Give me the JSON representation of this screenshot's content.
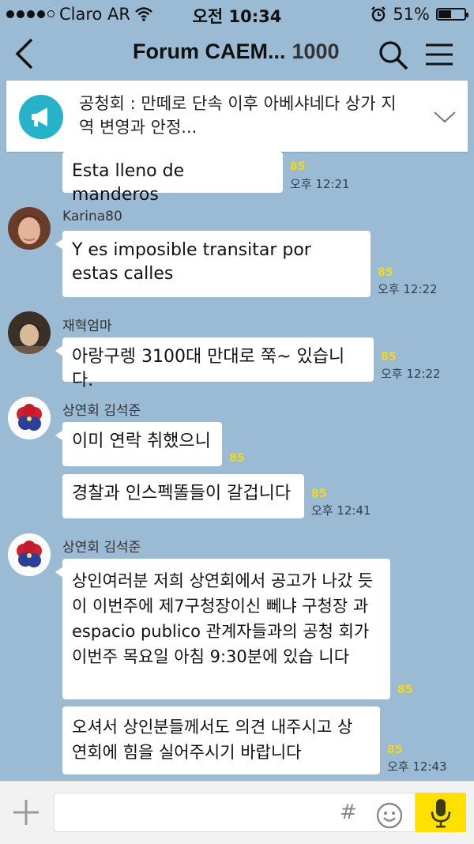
{
  "status": {
    "carrier": "Claro AR",
    "time": "오전 10:34",
    "battery": "51%",
    "battery_level": 0.51
  },
  "header": {
    "title": "Forum CAEM...",
    "member_count": "1000"
  },
  "notice": {
    "text": "공청회 : 만떼로 단속 이후 아베샤네다 상가 지역 변영과 안정..."
  },
  "messages": [
    {
      "text": "Esta lleno de manderos",
      "unread": "85",
      "time": "오후 12:21"
    },
    {
      "sender": "Karina80",
      "text": "Y es imposible transitar por estas calles",
      "unread": "85",
      "time": "오후 12:22"
    },
    {
      "sender": "재혁엄마",
      "text": "아랑구렝 3100대 만대로 쭉~ 있습니다.",
      "unread": "85",
      "time": "오후 12:22"
    },
    {
      "sender": "상연회 김석준",
      "text": "이미 연락 취했으니",
      "unread": "85"
    },
    {
      "text": "경찰과 인스펙똘들이 갈겁니다",
      "unread": "85",
      "time": "오후 12:41"
    },
    {
      "sender": "상연회 김석준",
      "text": "상인여러분 저희 상연회에서 공고가 나갔 듯이 이번주에 제7구청장이신 뻬냐 구청장 과 espacio publico 관계자들과의 공청 회가 이번주 목요일 아침 9:30분에 있습 니다",
      "unread": "85"
    },
    {
      "text": "오셔서 상인분들께서도 의견 내주시고 상 연회에 힘을 실어주시기 바랍니다",
      "unread": "85",
      "time": "오후 12:43"
    }
  ],
  "input": {
    "hash": "#"
  },
  "colors": {
    "background": "#9bbbd4",
    "unread": "#f2d71a",
    "notice_icon": "#26b3c9",
    "mic_button": "#ffe000"
  }
}
